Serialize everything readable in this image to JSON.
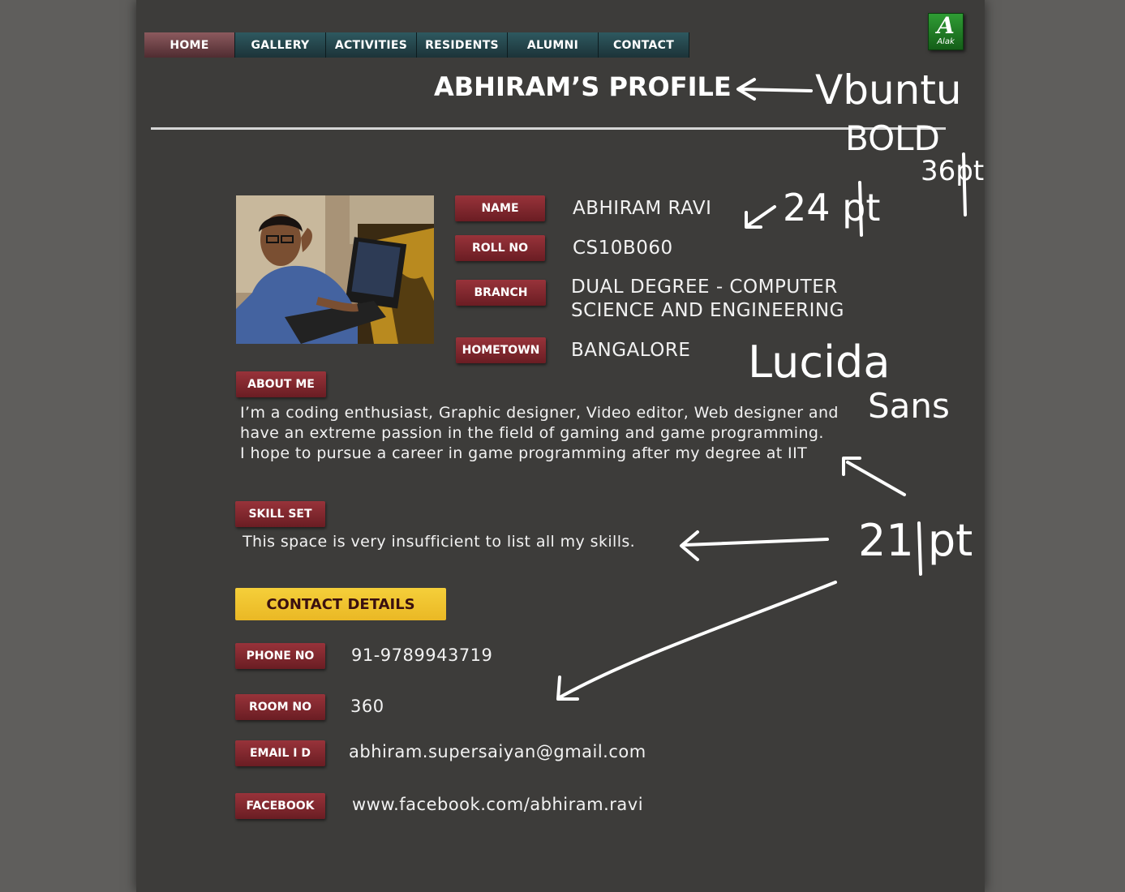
{
  "nav": {
    "items": [
      {
        "label": "HOME",
        "active": true
      },
      {
        "label": "GALLERY",
        "active": false
      },
      {
        "label": "ACTIVITIES",
        "active": false
      },
      {
        "label": "RESIDENTS",
        "active": false
      },
      {
        "label": "ALUMNI",
        "active": false
      },
      {
        "label": "CONTACT",
        "active": false
      }
    ]
  },
  "logo": {
    "letter": "A",
    "name": "Alak"
  },
  "header": {
    "title": "ABHIRAM’S PROFILE"
  },
  "profile": {
    "name_label": "NAME",
    "name_value": "ABHIRAM RAVI",
    "roll_label": "ROLL NO",
    "roll_value": "CS10B060",
    "branch_label": "BRANCH",
    "branch_value_line1": "DUAL DEGREE - COMPUTER",
    "branch_value_line2": "SCIENCE AND ENGINEERING",
    "hometown_label": "HOMETOWN",
    "hometown_value": "BANGALORE"
  },
  "about": {
    "label": "ABOUT ME",
    "lines": [
      "I’m a coding enthusiast, Graphic designer, Video editor, Web designer and",
      "have an extreme passion in the field of gaming and game programming.",
      "I hope to pursue a career in game programming after my degree at IIT"
    ]
  },
  "skills": {
    "label": "SKILL SET",
    "text": "This space is very insufficient to list all my skills."
  },
  "contact": {
    "heading": "CONTACT DETAILS",
    "phone_label": "PHONE NO",
    "phone_value": "91-9789943719",
    "room_label": "ROOM NO",
    "room_value": "360",
    "email_label": "EMAIL I D",
    "email_value": "abhiram.supersaiyan@gmail.com",
    "facebook_label": "FACEBOOK",
    "facebook_value": "www.facebook.com/abhiram.ravi"
  },
  "annotations": {
    "font_title": "Vbuntu",
    "bold": "BOLD",
    "size_24": "24 pt",
    "size_36": "36pt",
    "font_body_1": "Lucida",
    "font_body_2": "Sans",
    "size_21": "21 pt"
  },
  "colors": {
    "background": "#5f5e5c",
    "panel": "#3d3c3a",
    "nav": "#1c3338",
    "nav_active": "#6e4448",
    "tag": "#7d252c",
    "contact_button": "#f2c431",
    "logo": "#1f7a24"
  }
}
